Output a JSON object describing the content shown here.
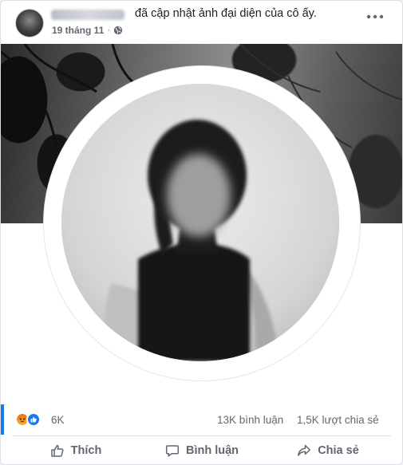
{
  "post": {
    "author_name": "Trang Nguyen",
    "action": "đã cập nhật ảnh đại diện của cô ấy.",
    "time": "19 tháng 11",
    "separator": "·",
    "privacy_icon": "globe-icon",
    "more_icon": "more-horizontal-icon"
  },
  "stats": {
    "reactions": [
      "angry-reaction-icon",
      "like-reaction-icon"
    ],
    "reaction_count": "6K",
    "comment_count": "13K bình luận",
    "share_count": "1,5K lượt chia sẻ"
  },
  "actions": {
    "like_label": "Thích",
    "comment_label": "Bình luận",
    "share_label": "Chia sẻ"
  },
  "colors": {
    "accent": "#1877f2",
    "secondary_text": "#606770",
    "primary_text": "#1c1e21",
    "angry": "#e9710f"
  }
}
